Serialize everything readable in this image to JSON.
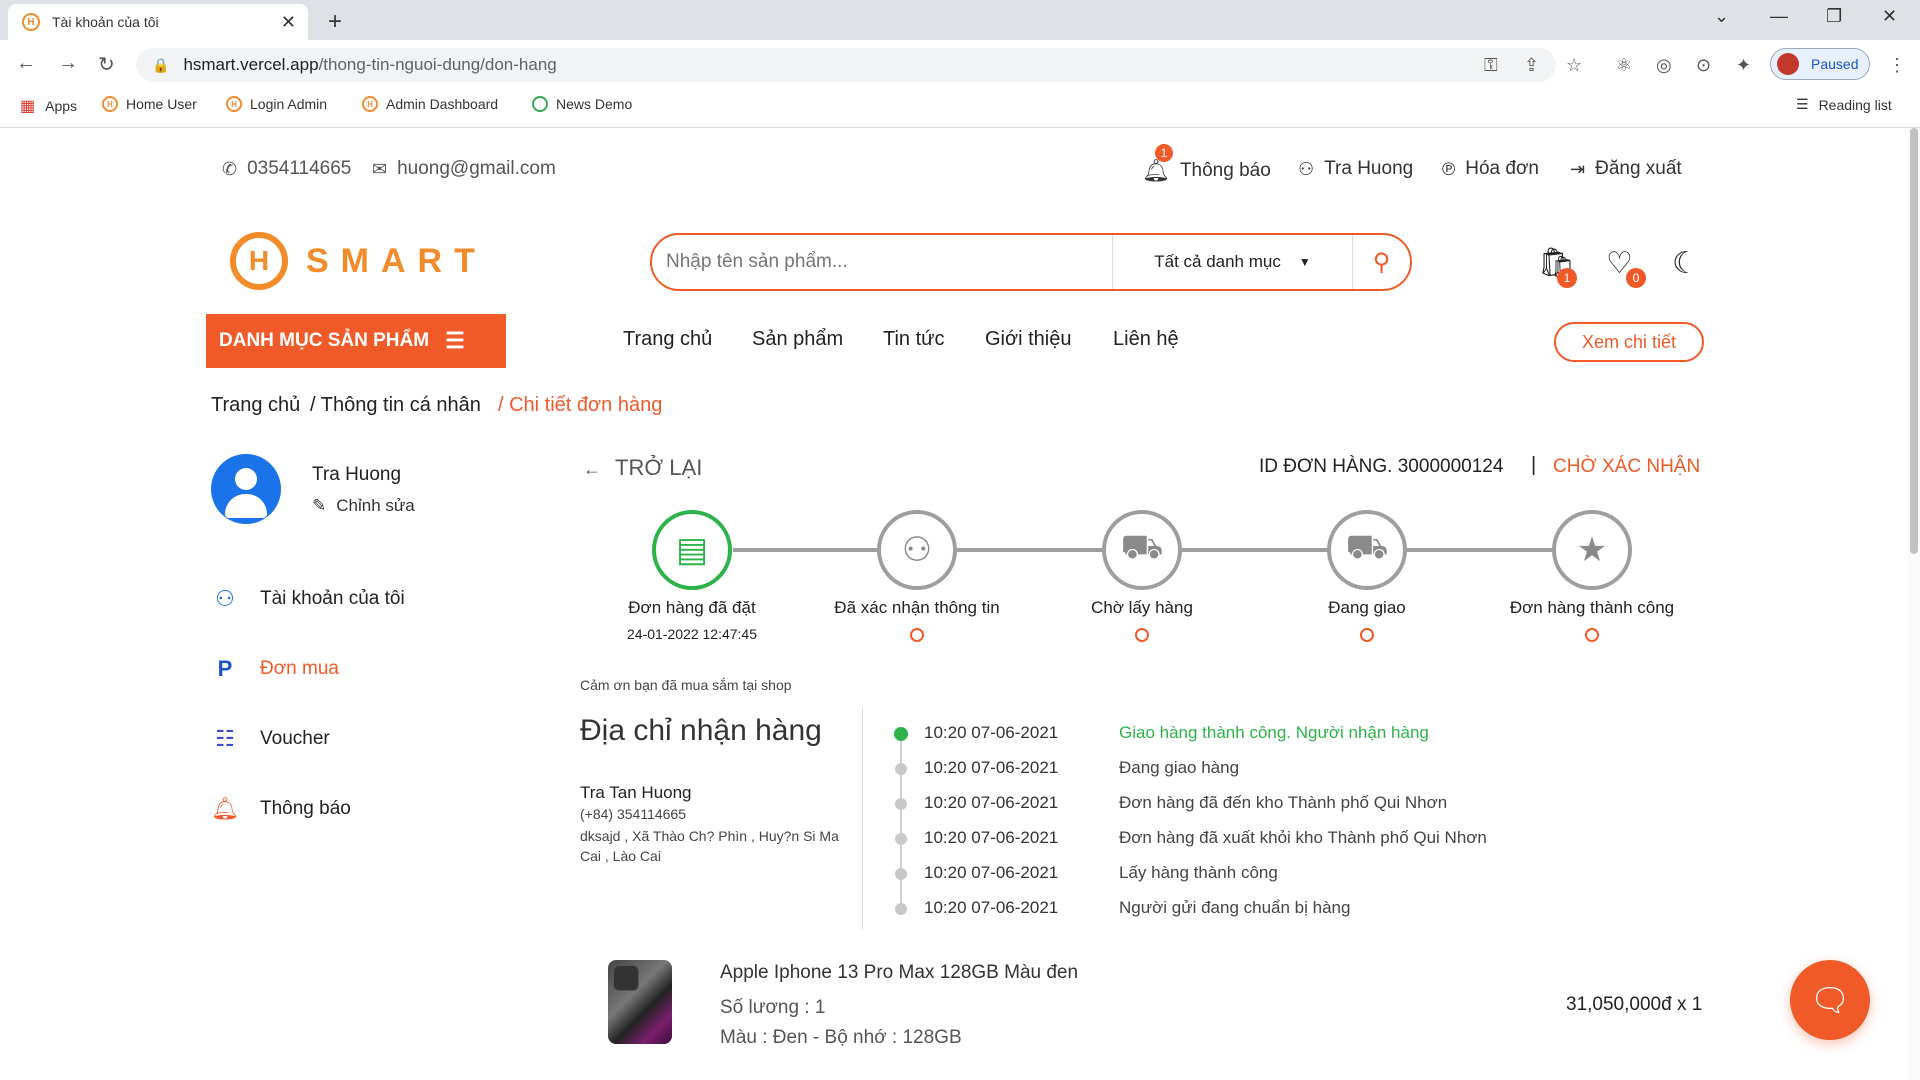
{
  "browser": {
    "tab_title": "Tài khoản của tôi",
    "url_host": "hsmart.vercel.app",
    "url_path": "/thong-tin-nguoi-dung/don-hang",
    "profile_status": "Paused",
    "bookmarks": [
      "Apps",
      "Home User",
      "Login Admin",
      "Admin Dashboard",
      "News Demo"
    ],
    "reading_list": "Reading list"
  },
  "topbar": {
    "phone": "0354114665",
    "email": "huong@gmail.com",
    "notifications_label": "Thông báo",
    "notifications_count": "1",
    "user_label": "Tra Huong",
    "invoice_label": "Hóa đơn",
    "logout_label": "Đăng xuất"
  },
  "header": {
    "logo_letter": "H",
    "logo_text": "SMART",
    "search_placeholder": "Nhập tên sản phẩm...",
    "category_select": "Tất cả danh mục",
    "cart_count": "1",
    "wishlist_count": "0"
  },
  "nav": {
    "category_button": "DANH MỤC SẢN PHẨM",
    "links": [
      "Trang chủ",
      "Sản phẩm",
      "Tin tức",
      "Giới thiệu",
      "Liên hệ"
    ],
    "detail_button": "Xem chi tiết"
  },
  "breadcrumb": {
    "home": "Trang chủ",
    "profile": "/ Thông tin cá nhân",
    "current": "/ Chi tiết đơn hàng"
  },
  "sidebar": {
    "username": "Tra Huong",
    "edit": "Chỉnh sửa",
    "items": [
      "Tài khoản của tôi",
      "Đơn mua",
      "Voucher",
      "Thông báo"
    ]
  },
  "order": {
    "back": "TRỞ LẠI",
    "id_label": "ID ĐƠN HÀNG. 3000000124",
    "separator": "|",
    "status": "CHỜ XÁC NHẬN",
    "steps": [
      {
        "label": "Đơn hàng đã đặt",
        "time": "24-01-2022 12:47:45"
      },
      {
        "label": "Đã xác nhận thông tin"
      },
      {
        "label": "Chờ lấy hàng"
      },
      {
        "label": "Đang giao"
      },
      {
        "label": "Đơn hàng thành công"
      }
    ],
    "thanks": "Cảm ơn bạn đã mua sắm tại shop",
    "address_title": "Địa chỉ nhận hàng",
    "receiver_name": "Tra Tan Huong",
    "receiver_phone": "(+84) 354114665",
    "receiver_address": "dksajd , Xã Thào Ch? Phìn , Huy?n Si Ma Cai , Lào Cai",
    "timeline": [
      {
        "time": "10:20 07-06-2021",
        "desc": "Giao hàng thành công. Người nhận hàng"
      },
      {
        "time": "10:20 07-06-2021",
        "desc": "Đang giao hàng"
      },
      {
        "time": "10:20 07-06-2021",
        "desc": "Đơn hàng đã đến kho Thành phố Qui Nhơn"
      },
      {
        "time": "10:20 07-06-2021",
        "desc": "Đơn hàng đã xuất khỏi kho Thành phố Qui Nhơn"
      },
      {
        "time": "10:20 07-06-2021",
        "desc": "Lấy hàng thành công"
      },
      {
        "time": "10:20 07-06-2021",
        "desc": "Người gửi đang chuẩn bị hàng"
      }
    ],
    "product": {
      "name": "Apple Iphone 13 Pro Max 128GB Màu đen",
      "quantity": "Số lương : 1",
      "variant": "Màu : Đen - Bộ nhớ : 128GB",
      "price": "31,050,000đ x 1"
    }
  },
  "colors": {
    "accent": "#f05a28",
    "success": "#2db34a",
    "logo": "#f28b2a"
  }
}
